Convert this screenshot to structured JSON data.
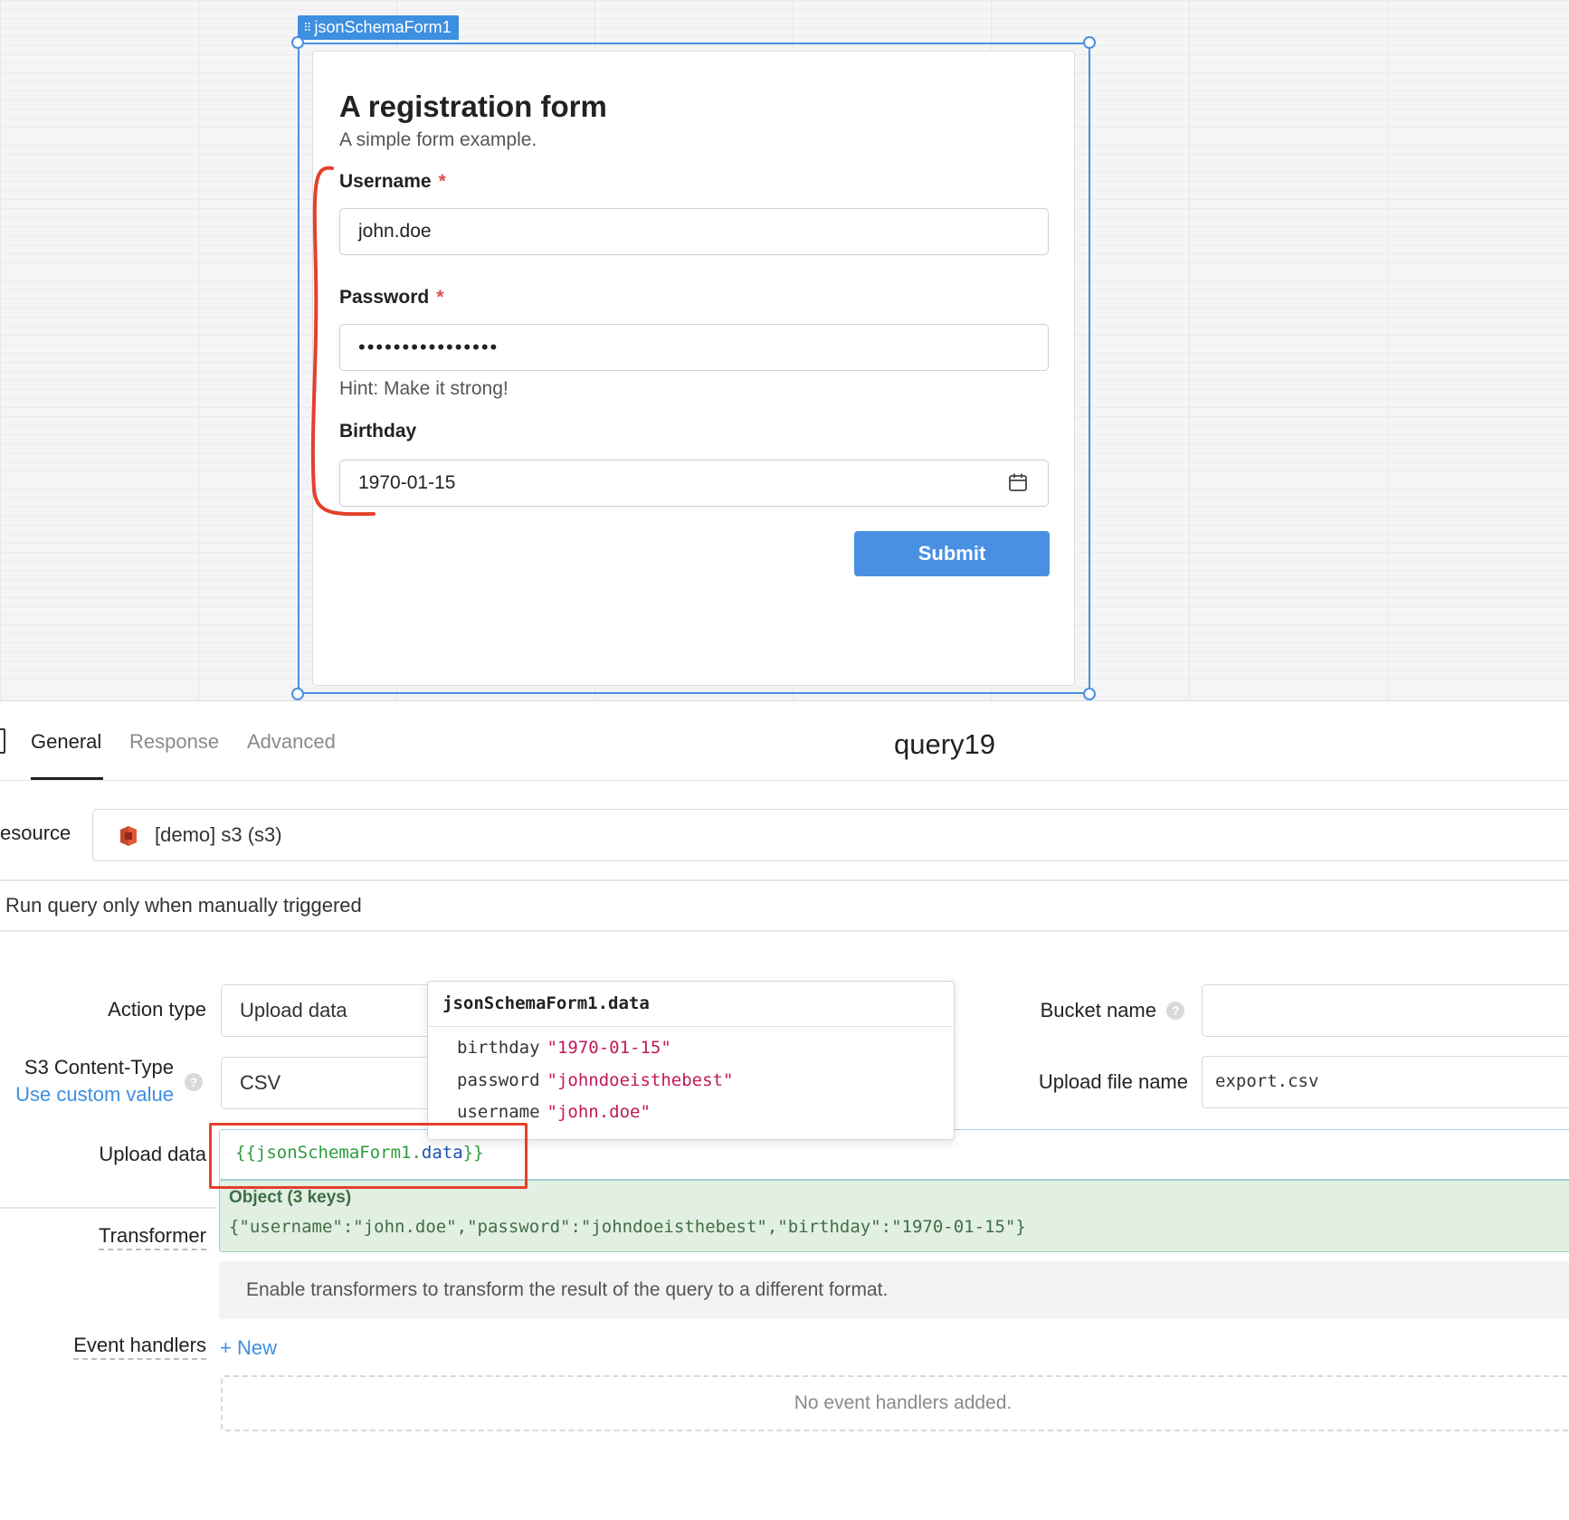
{
  "widget": {
    "tag_label": "jsonSchemaForm1"
  },
  "form": {
    "title": "A registration form",
    "description": "A simple form example.",
    "username_label": "Username",
    "username_value": "john.doe",
    "password_label": "Password",
    "password_masked": "••••••••••••••••",
    "password_hint": "Hint: Make it strong!",
    "birthday_label": "Birthday",
    "birthday_value": "1970-01-15",
    "required_mark": "*",
    "submit_label": "Submit"
  },
  "query_editor": {
    "tabs": [
      "General",
      "Response",
      "Advanced"
    ],
    "active_tab": "General",
    "query_name": "query19",
    "resource_label": "esource",
    "resource_value": "[demo] s3 (s3)",
    "run_mode": "Run query only when manually triggered",
    "action_type_label": "Action type",
    "action_type_value": "Upload data",
    "content_type_label": "S3 Content-Type",
    "content_type_link": "Use custom value",
    "content_type_value": "CSV",
    "bucket_label": "Bucket name",
    "bucket_value": "",
    "upload_file_label": "Upload file name",
    "upload_file_value": "export.csv",
    "upload_data_label": "Upload data",
    "upload_data_open": "{{jsonSchemaForm1.",
    "upload_data_prop": "data",
    "upload_data_close": "}}",
    "result_title": "Object (3 keys)",
    "result_json": "{\"username\":\"john.doe\",\"password\":\"johndoeisthebest\",\"birthday\":\"1970-01-15\"}",
    "transformer_label": "Transformer",
    "transformer_hint": "Enable transformers to transform the result of the query to a different format.",
    "event_handlers_label": "Event handlers",
    "new_label": "+ New",
    "no_handlers": "No event handlers added."
  },
  "autocomplete": {
    "header": "jsonSchemaForm1.data",
    "rows": [
      {
        "key": "birthday",
        "value": "\"1970-01-15\""
      },
      {
        "key": "password",
        "value": "\"johndoeisthebest\""
      },
      {
        "key": "username",
        "value": "\"john.doe\""
      }
    ]
  },
  "colors": {
    "accent": "#4a90e2",
    "annotation_red": "#e5402a",
    "result_green_bg": "#e2efe3",
    "string_value": "#c2185b"
  },
  "icons": [
    "drag-handle-icon",
    "calendar-icon",
    "s3-bucket-icon",
    "help-icon"
  ]
}
